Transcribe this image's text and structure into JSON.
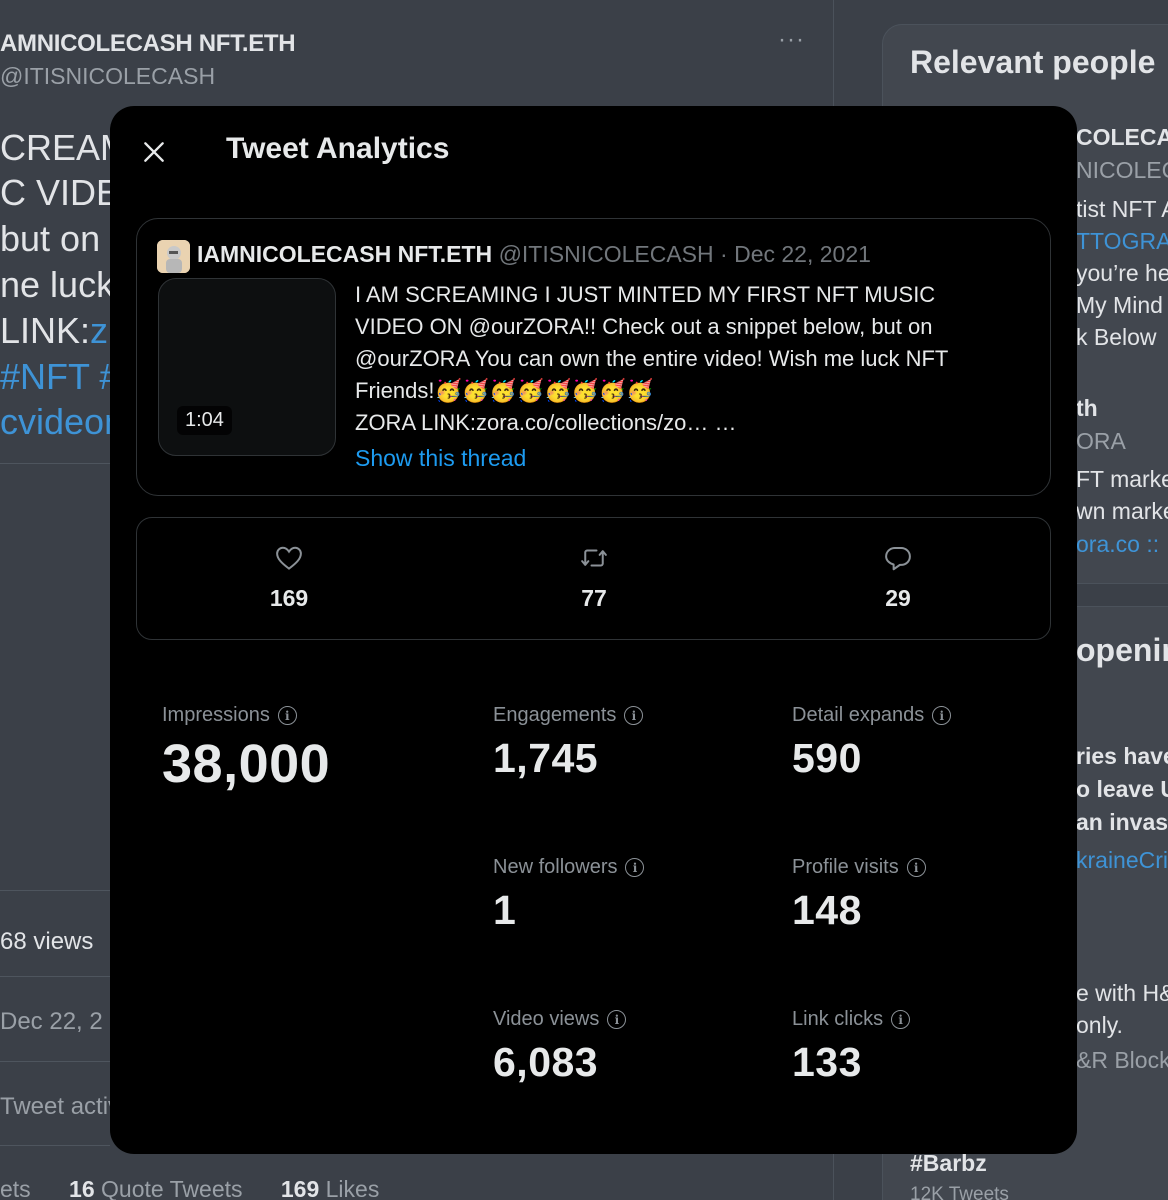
{
  "background": {
    "name": "AMNICOLECASH NFT.ETH",
    "handle": "@ITISNICOLECASH",
    "more": "···",
    "text_lines": [
      "CREAM",
      "C VIDEO",
      " but on",
      "ne luck",
      "LINK:",
      "#NFT #",
      "cvideon"
    ],
    "text_lines_blue_parts": [
      "z",
      "cvideon"
    ],
    "views": "68 views",
    "date": "Dec 22, 2",
    "activity": "Tweet activ",
    "stats": {
      "left": "ets",
      "quote_count": "16",
      "quote_label": "Quote Tweets",
      "likes_count": "169",
      "likes_label": "Likes"
    },
    "sidebar": {
      "relevant_title": "Relevant people",
      "relevant_lines": [
        "COLECA",
        "NICOLEC",
        "tist NFT A",
        "TTOGRA",
        "you’re he",
        "My Mind I",
        "k Below"
      ],
      "second_person": [
        "th",
        "ORA",
        "FT marke",
        "wn marke",
        "ora.co ::"
      ],
      "happening_title": "openin",
      "trend_lines": [
        "ries have",
        "o leave U",
        "an invas",
        "kraineCris"
      ],
      "promo_lines": [
        "e with H&",
        "only.",
        "&R Block"
      ],
      "trend_tag": "#Barbz",
      "trend_count": "12K Tweets"
    }
  },
  "modal": {
    "title": "Tweet Analytics",
    "tweet": {
      "name": "IAMNICOLECASH NFT.ETH",
      "handle": "@ITISNICOLECASH",
      "separator": " · ",
      "date": "Dec 22, 2021",
      "duration": "1:04",
      "text_lines": [
        "I AM SCREAMING I JUST MINTED MY FIRST NFT MUSIC",
        "VIDEO ON @ourZORA!! Check out a snippet below, but on",
        "@ourZORA You can own the entire video! Wish me luck NFT",
        "Friends!🥳🥳🥳🥳🥳🥳🥳🥳",
        "ZORA LINK:zora.co/collections/zo… …"
      ],
      "show_thread": "Show this thread"
    },
    "metrics": {
      "likes": "169",
      "retweets": "77",
      "replies": "29"
    },
    "stats": {
      "impressions": {
        "label": "Impressions",
        "value": "38,000"
      },
      "engagements": {
        "label": "Engagements",
        "value": "1,745"
      },
      "detail_expands": {
        "label": "Detail expands",
        "value": "590"
      },
      "new_followers": {
        "label": "New followers",
        "value": "1"
      },
      "profile_visits": {
        "label": "Profile visits",
        "value": "148"
      },
      "video_views": {
        "label": "Video views",
        "value": "6,083"
      },
      "link_clicks": {
        "label": "Link clicks",
        "value": "133"
      }
    },
    "info_glyph": "i"
  }
}
